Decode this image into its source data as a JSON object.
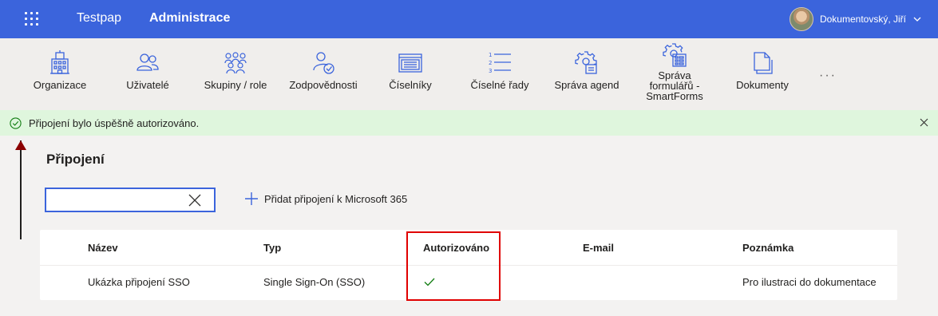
{
  "topbar": {
    "app_name": "Testpap",
    "section": "Administrace",
    "user_name": "Dokumentovský, Jiří"
  },
  "ribbon": {
    "items": [
      {
        "label": "Organizace",
        "icon": "organization-icon"
      },
      {
        "label": "Uživatelé",
        "icon": "users-icon"
      },
      {
        "label": "Skupiny / role",
        "icon": "groups-icon"
      },
      {
        "label": "Zodpovědnosti",
        "icon": "responsibility-icon"
      },
      {
        "label": "Číselníky",
        "icon": "codelist-icon"
      },
      {
        "label": "Číselné řady",
        "icon": "numbered-list-icon"
      },
      {
        "label": "Správa agend",
        "icon": "agenda-settings-icon"
      },
      {
        "label": "Správa formulářů - SmartForms",
        "icon": "form-settings-icon"
      },
      {
        "label": "Dokumenty",
        "icon": "documents-icon"
      }
    ],
    "more": "···"
  },
  "banner": {
    "message": "Připojení bylo úspěšně autorizováno."
  },
  "page": {
    "title": "Připojení",
    "search_value": "",
    "add_label": "Přidat připojení k Microsoft 365"
  },
  "table": {
    "columns": [
      "Název",
      "Typ",
      "Autorizováno",
      "E-mail",
      "Poznámka"
    ],
    "rows": [
      {
        "name": "Ukázka připojení SSO",
        "type": "Single Sign-On (SSO)",
        "authorized": true,
        "email": "",
        "note": "Pro ilustraci do dokumentace"
      }
    ]
  },
  "colors": {
    "accent": "#3b64dc",
    "success_bg": "#dff6dd",
    "success": "#107c10",
    "highlight": "#e00000"
  }
}
